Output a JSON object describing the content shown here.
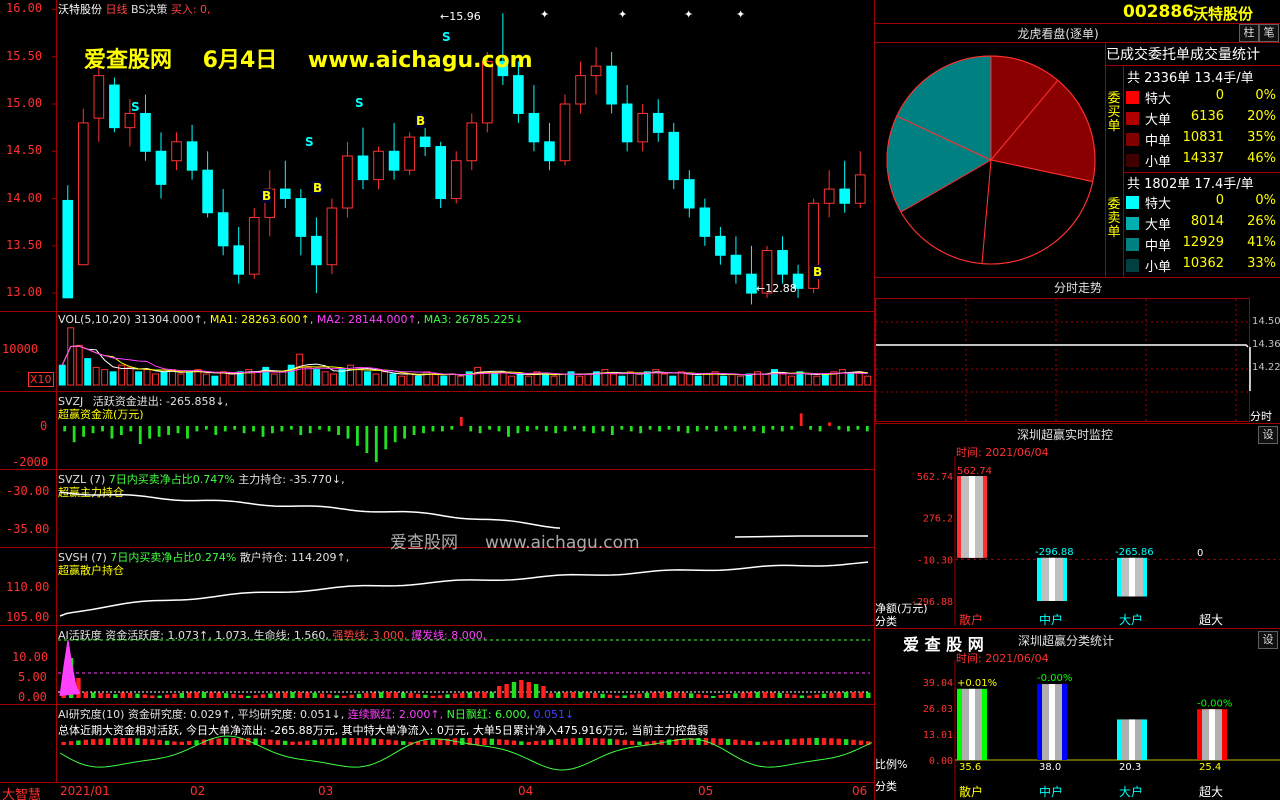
{
  "main": {
    "title_stock": "沃特股份",
    "title_period": "日线",
    "title_bs": "BS决策",
    "title_buy": "买入: 0,",
    "watermark": "爱查股网    6月4日    www.aichagu.com",
    "yticks": [
      "16.00",
      "15.50",
      "15.00",
      "14.50",
      "14.00",
      "13.50",
      "13.00"
    ],
    "high_label": "15.96",
    "low_label": "12.88",
    "marks_s": [
      "S",
      "S",
      "S",
      "S"
    ],
    "marks_b": [
      "B",
      "B",
      "B",
      "B",
      "B"
    ],
    "candles_ohlc": [
      [
        13.98,
        14.14,
        13.0,
        12.95
      ],
      [
        13.3,
        14.95,
        13.3,
        14.8
      ],
      [
        14.85,
        15.42,
        14.6,
        15.3
      ],
      [
        15.2,
        15.28,
        14.7,
        14.75
      ],
      [
        14.75,
        15.05,
        14.55,
        14.9
      ],
      [
        14.9,
        15.1,
        14.4,
        14.5
      ],
      [
        14.5,
        14.7,
        14.0,
        14.15
      ],
      [
        14.4,
        14.7,
        14.3,
        14.6
      ],
      [
        14.6,
        14.78,
        14.2,
        14.3
      ],
      [
        14.3,
        14.5,
        13.8,
        13.85
      ],
      [
        13.85,
        14.1,
        13.4,
        13.5
      ],
      [
        13.5,
        13.7,
        13.1,
        13.2
      ],
      [
        13.2,
        13.9,
        13.15,
        13.8
      ],
      [
        13.8,
        14.3,
        13.6,
        14.1
      ],
      [
        14.1,
        14.4,
        13.9,
        14.0
      ],
      [
        14.0,
        14.1,
        13.4,
        13.6
      ],
      [
        13.6,
        13.8,
        13.0,
        13.3
      ],
      [
        13.3,
        14.0,
        13.2,
        13.9
      ],
      [
        13.9,
        14.6,
        13.8,
        14.45
      ],
      [
        14.45,
        14.75,
        14.1,
        14.2
      ],
      [
        14.2,
        14.55,
        14.1,
        14.5
      ],
      [
        14.5,
        14.8,
        14.2,
        14.3
      ],
      [
        14.3,
        14.7,
        14.25,
        14.65
      ],
      [
        14.65,
        14.8,
        14.45,
        14.55
      ],
      [
        14.55,
        14.6,
        13.9,
        14.0
      ],
      [
        14.0,
        14.5,
        13.95,
        14.4
      ],
      [
        14.4,
        14.9,
        14.3,
        14.8
      ],
      [
        14.8,
        15.55,
        14.7,
        15.45
      ],
      [
        15.45,
        15.96,
        15.2,
        15.3
      ],
      [
        15.3,
        15.45,
        14.8,
        14.9
      ],
      [
        14.9,
        15.2,
        14.5,
        14.6
      ],
      [
        14.6,
        14.8,
        14.3,
        14.4
      ],
      [
        14.4,
        15.1,
        14.35,
        15.0
      ],
      [
        15.0,
        15.45,
        14.9,
        15.3
      ],
      [
        15.3,
        15.6,
        15.1,
        15.4
      ],
      [
        15.4,
        15.55,
        14.9,
        15.0
      ],
      [
        15.0,
        15.2,
        14.5,
        14.6
      ],
      [
        14.6,
        15.0,
        14.5,
        14.9
      ],
      [
        14.9,
        15.05,
        14.6,
        14.7
      ],
      [
        14.7,
        14.8,
        14.1,
        14.2
      ],
      [
        14.2,
        14.3,
        13.8,
        13.9
      ],
      [
        13.9,
        14.0,
        13.5,
        13.6
      ],
      [
        13.6,
        13.7,
        13.3,
        13.4
      ],
      [
        13.4,
        13.6,
        13.1,
        13.2
      ],
      [
        13.2,
        13.5,
        12.88,
        13.0
      ],
      [
        13.0,
        13.5,
        12.95,
        13.45
      ],
      [
        13.45,
        13.6,
        13.1,
        13.2
      ],
      [
        13.2,
        13.3,
        12.95,
        13.05
      ],
      [
        13.05,
        14.0,
        13.0,
        13.95
      ],
      [
        13.95,
        14.3,
        13.8,
        14.1
      ],
      [
        14.1,
        14.4,
        13.85,
        13.95
      ],
      [
        13.95,
        14.5,
        13.9,
        14.25
      ]
    ],
    "price_min": 12.8,
    "price_max": 16.1
  },
  "vol": {
    "title_prefix": "VOL(5,10,20)",
    "vol_value": "31304.000↑",
    "ma1": "MA1: 28263.600↑",
    "ma2": "MA2: 28144.000↑",
    "ma3": "MA3: 26785.225↓",
    "ytick": "10000",
    "unit_box": "X10",
    "values": [
      9,
      26,
      18,
      12,
      8,
      7,
      6,
      9,
      8,
      6,
      7,
      5,
      6,
      7,
      5,
      6,
      7,
      5,
      4,
      6,
      5,
      6,
      7,
      6,
      8,
      5,
      6,
      9,
      14,
      8,
      7,
      6,
      5,
      7,
      9,
      8,
      6,
      5,
      6,
      5,
      4,
      5,
      4,
      6,
      5,
      4,
      5,
      4,
      6,
      8,
      6,
      5,
      6,
      4,
      5,
      4,
      6,
      5,
      4,
      5,
      6,
      4,
      5,
      6,
      7,
      5,
      4,
      6,
      5,
      6,
      7,
      5,
      4,
      6,
      5,
      4,
      5,
      6,
      4,
      5,
      4,
      5,
      6,
      5,
      7,
      5,
      4,
      6,
      5,
      4,
      5,
      6,
      7,
      5,
      6,
      4
    ]
  },
  "svzj": {
    "label1": "SVZJ",
    "label2": "活跃资金进出: -265.858↓,",
    "sub": "超赢资金流(万元)",
    "yticks": [
      "0",
      "-2000"
    ],
    "values": [
      -300,
      -900,
      -600,
      -400,
      -300,
      -700,
      -500,
      -300,
      -1000,
      -700,
      -600,
      -500,
      -400,
      -700,
      -300,
      -200,
      -500,
      -300,
      -200,
      -400,
      -300,
      -600,
      -400,
      -300,
      -200,
      -500,
      -400,
      -200,
      -300,
      -500,
      -700,
      -1100,
      -1500,
      -2000,
      -1300,
      -900,
      -700,
      -500,
      -400,
      -300,
      -300,
      -200,
      500,
      -300,
      -400,
      -200,
      -300,
      -600,
      -400,
      -300,
      -200,
      -300,
      -400,
      -300,
      -200,
      -300,
      -400,
      -300,
      -500,
      -200,
      -300,
      -400,
      -200,
      -300,
      -200,
      -300,
      -400,
      -300,
      -200,
      -300,
      -200,
      -300,
      -200,
      -300,
      -400,
      -200,
      -300,
      -200,
      700,
      -200,
      -300,
      200,
      -200,
      -300,
      -200,
      -300
    ]
  },
  "svzl": {
    "label1": "SVZL",
    "label2": "(7)",
    "label3": "7日内买卖净占比0.747%",
    "label4": "主力持仓: -35.770↓,",
    "sub": "超赢主力持仓",
    "yticks": [
      "-30.00",
      "-35.00"
    ],
    "watermark": "爱查股网     www.aichagu.com"
  },
  "svsh": {
    "label1": "SVSH",
    "label2": "(7)",
    "label3": "7日内买卖净占比0.274%",
    "label4": "散户持仓: 114.209↑,",
    "sub": "超赢散户持仓",
    "yticks": [
      "110.00",
      "105.00"
    ]
  },
  "ai_active": {
    "label1": "AI活跃度",
    "label2": "资金活跃度: 1.073↑, 1.073, 生命线: 1.560,",
    "label3": "强势线: 3.000,",
    "label4": "爆发线: 8.000,",
    "yticks": [
      "10.00",
      "5.00",
      "0.00"
    ]
  },
  "ai_research": {
    "label1": "AI研究度",
    "label2": "(10)",
    "label3": "资金研究度: 0.029↑, 平均研究度: 0.051↓,",
    "label4": "连续飘红: 2.000↑,",
    "label5": "N日飘红: 6.000,",
    "label6": "0.051↓",
    "summary": "总体近期大资金相对活跃, 今日大单净流出: -265.88万元, 其中特大单净流入: 0万元, 大单5日累计净入475.916万元, 当前主力控盘弱"
  },
  "xaxis": {
    "brand": "大智慧",
    "labels": [
      "2021/01",
      "02",
      "03",
      "04",
      "05",
      "06"
    ]
  },
  "right": {
    "code": "002886",
    "name": "沃特股份",
    "btn1": "柱",
    "btn2": "笔",
    "tiger_title": "龙虎看盘(逐单)",
    "tiger_sub": "已成交委托单成交量统计",
    "buy_label": "委买单",
    "sell_label": "委卖单",
    "buy_total": "共 2336单 13.4手/单",
    "sell_total": "共 1802单 17.4手/单",
    "buy_rows": [
      {
        "name": "特大",
        "num": "0",
        "pct": "0%",
        "color": "#ff0000"
      },
      {
        "name": "大单",
        "num": "6136",
        "pct": "20%",
        "color": "#b00000"
      },
      {
        "name": "中单",
        "num": "10831",
        "pct": "35%",
        "color": "#800000"
      },
      {
        "name": "小单",
        "num": "14337",
        "pct": "46%",
        "color": "#400000"
      }
    ],
    "sell_rows": [
      {
        "name": "特大",
        "num": "0",
        "pct": "0%",
        "color": "#00ffff"
      },
      {
        "name": "大单",
        "num": "8014",
        "pct": "26%",
        "color": "#00b0b0"
      },
      {
        "name": "中单",
        "num": "12929",
        "pct": "41%",
        "color": "#008080"
      },
      {
        "name": "小单",
        "num": "10362",
        "pct": "33%",
        "color": "#004040"
      }
    ],
    "timeshare_title": "分时走势",
    "ts_ticks": [
      "14.50",
      "14.36",
      "14.22"
    ],
    "ts_unit": "分时",
    "monitor_title": "深圳超赢实时监控",
    "monitor_btn": "设",
    "monitor_time": "时间: 2021/06/04",
    "monitor_yticks": [
      "562.74",
      "276.2",
      "-10.30",
      "-296.88"
    ],
    "monitor_vals": [
      {
        "cat": "散户",
        "value": 562.74,
        "label": "562.74"
      },
      {
        "cat": "中户",
        "value": -296.88,
        "label": "-296.88"
      },
      {
        "cat": "大户",
        "value": -265.86,
        "label": "-265.86"
      },
      {
        "cat": "超大",
        "value": 0,
        "label": "0"
      }
    ],
    "monitor_ylab1": "净额(万元)",
    "monitor_ylab2": "分类",
    "class_brand": "爱 查 股 网",
    "class_title": "深圳超赢分类统计",
    "class_btn": "设",
    "class_time": "时间: 2021/06/04",
    "class_yticks": [
      "39.04",
      "26.03",
      "13.01",
      "0.00"
    ],
    "class_vals": [
      {
        "cat": "散户",
        "value": 35.6,
        "label": "35.6",
        "top": "+0.01%",
        "color": "#00ff00"
      },
      {
        "cat": "中户",
        "value": 38.0,
        "label": "38.0",
        "top": "-0.00%",
        "color": "#0000ff"
      },
      {
        "cat": "大户",
        "value": 20.3,
        "label": "20.3",
        "top": "",
        "color": "#00ffff"
      },
      {
        "cat": "超大",
        "value": 25.4,
        "label": "25.4",
        "top": "-0.00%",
        "color": "#ff0000"
      }
    ],
    "class_ylab1": "比例%",
    "class_ylab2": "分类"
  },
  "chart_data": {
    "type": "bar",
    "title": "深圳超赢实时监控",
    "categories": [
      "散户",
      "中户",
      "大户",
      "超大"
    ],
    "values": [
      562.74,
      -296.88,
      -265.86,
      0
    ],
    "ylabel": "净额(万元)",
    "ylim": [
      -296.88,
      562.74
    ]
  }
}
